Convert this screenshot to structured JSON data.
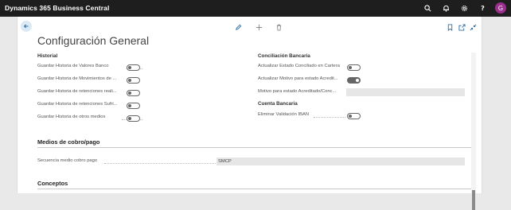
{
  "app": {
    "title": "Dynamics 365 Business Central",
    "avatar_initial": "G"
  },
  "topbar_icons": [
    "search-icon",
    "bell-icon",
    "gear-icon",
    "help-icon"
  ],
  "page": {
    "title": "Configuración General"
  },
  "actions": [
    "edit-icon",
    "add-icon",
    "delete-icon"
  ],
  "right_actions": [
    "bookmark-icon",
    "open-new-window-icon",
    "collapse-icon"
  ],
  "historial": {
    "title": "Historial",
    "rows": [
      {
        "label": "Guardar Historia de Valores Banco",
        "on": false
      },
      {
        "label": "Guardar Historia de Movimientos de ...",
        "on": false
      },
      {
        "label": "Guardar Historia de retenciones reali...",
        "on": false
      },
      {
        "label": "Guardar Historia de retenciones Sufri...",
        "on": false
      },
      {
        "label": "Guardar Historia de otros medios",
        "on": false
      }
    ]
  },
  "conciliacion": {
    "title": "Conciliación Bancaria",
    "rows": [
      {
        "label": "Actualizar Estado Conciliado en Cartera",
        "on": false
      },
      {
        "label": "Actualizar Motivo para estado Acredit...",
        "on": true
      }
    ],
    "motivo_label": "Motivo para estado Acreditado/Conc...",
    "motivo_value": ""
  },
  "cuenta": {
    "title": "Cuenta Bancaria",
    "rows": [
      {
        "label": "Eliminar Validación IBAN",
        "on": false
      }
    ]
  },
  "medios": {
    "title": "Medios de cobro/pago",
    "secuencia_label": "Secuencia medio cobro pago",
    "secuencia_value": "SMCP"
  },
  "conceptos": {
    "title": "Conceptos"
  },
  "colors": {
    "topbar": "#1e1e1e",
    "avatar": "#9b2f8e",
    "accent": "#2e6da4",
    "toggle_on": "#666666"
  }
}
